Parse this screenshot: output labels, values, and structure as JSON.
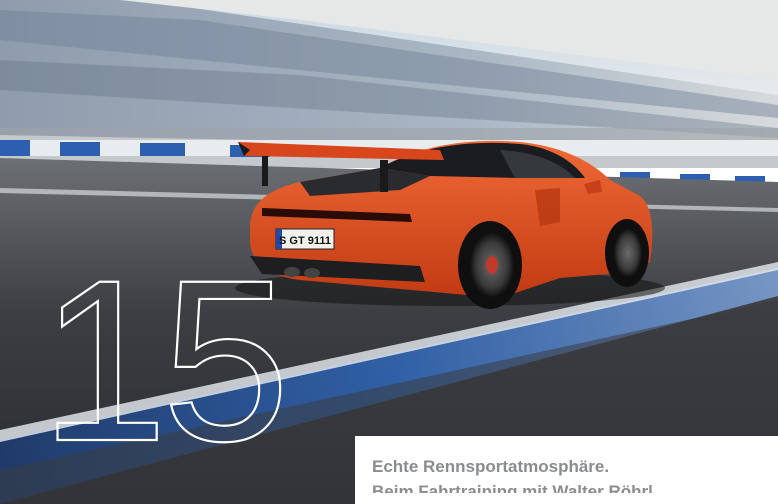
{
  "hero": {
    "big_number": "15",
    "license_plate": "S GT 9111",
    "caption_line_1": "Echte Rennsportatmosphäre.",
    "caption_line_2": "Beim Fahrtraining mit Walter Röhrl."
  },
  "colors": {
    "car": "#e1481e",
    "track": "#3c3e42",
    "curb_blue": "#2f66b8",
    "caption_text": "#8a8c8f",
    "outline": "#ffffff"
  }
}
